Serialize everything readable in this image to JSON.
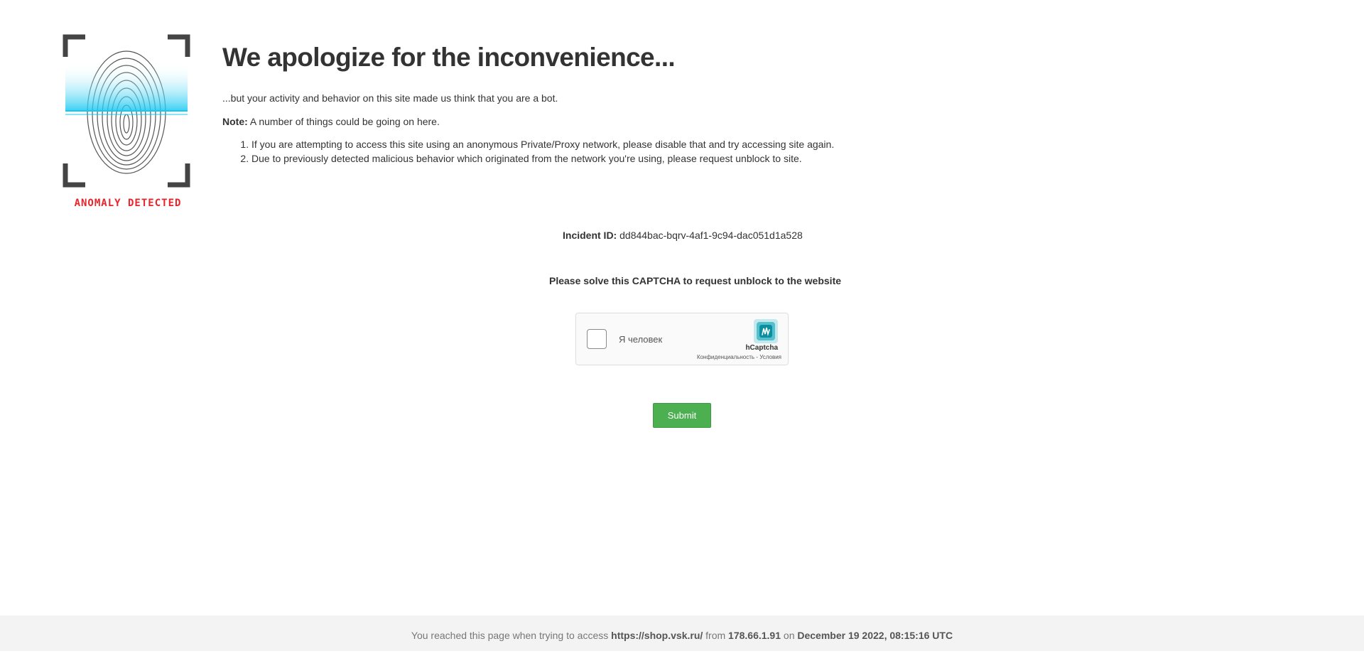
{
  "logo": {
    "caption": "ANOMALY DETECTED",
    "caption_color": "#e8242b",
    "scan_color": "#18c8f0",
    "icon": "fingerprint-scan-icon"
  },
  "heading": "We apologize for the inconvenience...",
  "intro": "...but your activity and behavior on this site made us think that you are a bot.",
  "note": {
    "label": "Note:",
    "text": " A number of things could be going on here."
  },
  "reasons": [
    "If you are attempting to access this site using an anonymous Private/Proxy network, please disable that and try accessing site again.",
    "Due to previously detected malicious behavior which originated from the network you're using, please request unblock to site."
  ],
  "incident": {
    "label": "Incident ID:",
    "value": " dd844bac-bqrv-4af1-9c94-dac051d1a528"
  },
  "captcha_prompt": "Please solve this CAPTCHA to request unblock to the website",
  "hcaptcha": {
    "checkbox_label": "Я человек",
    "brand": "hCaptcha",
    "links": "Конфиденциальность - Условия",
    "checked": false
  },
  "submit_label": "Submit",
  "footer": {
    "prefix": "You reached this page when trying to access ",
    "url": "https://shop.vsk.ru/",
    "from_text": " from ",
    "ip": "178.66.1.91",
    "on_text": " on ",
    "datetime": "December 19 2022, 08:15:16 UTC"
  },
  "colors": {
    "accent_green": "#4caf50",
    "footer_bg": "#f3f3f3",
    "text": "#333333"
  }
}
